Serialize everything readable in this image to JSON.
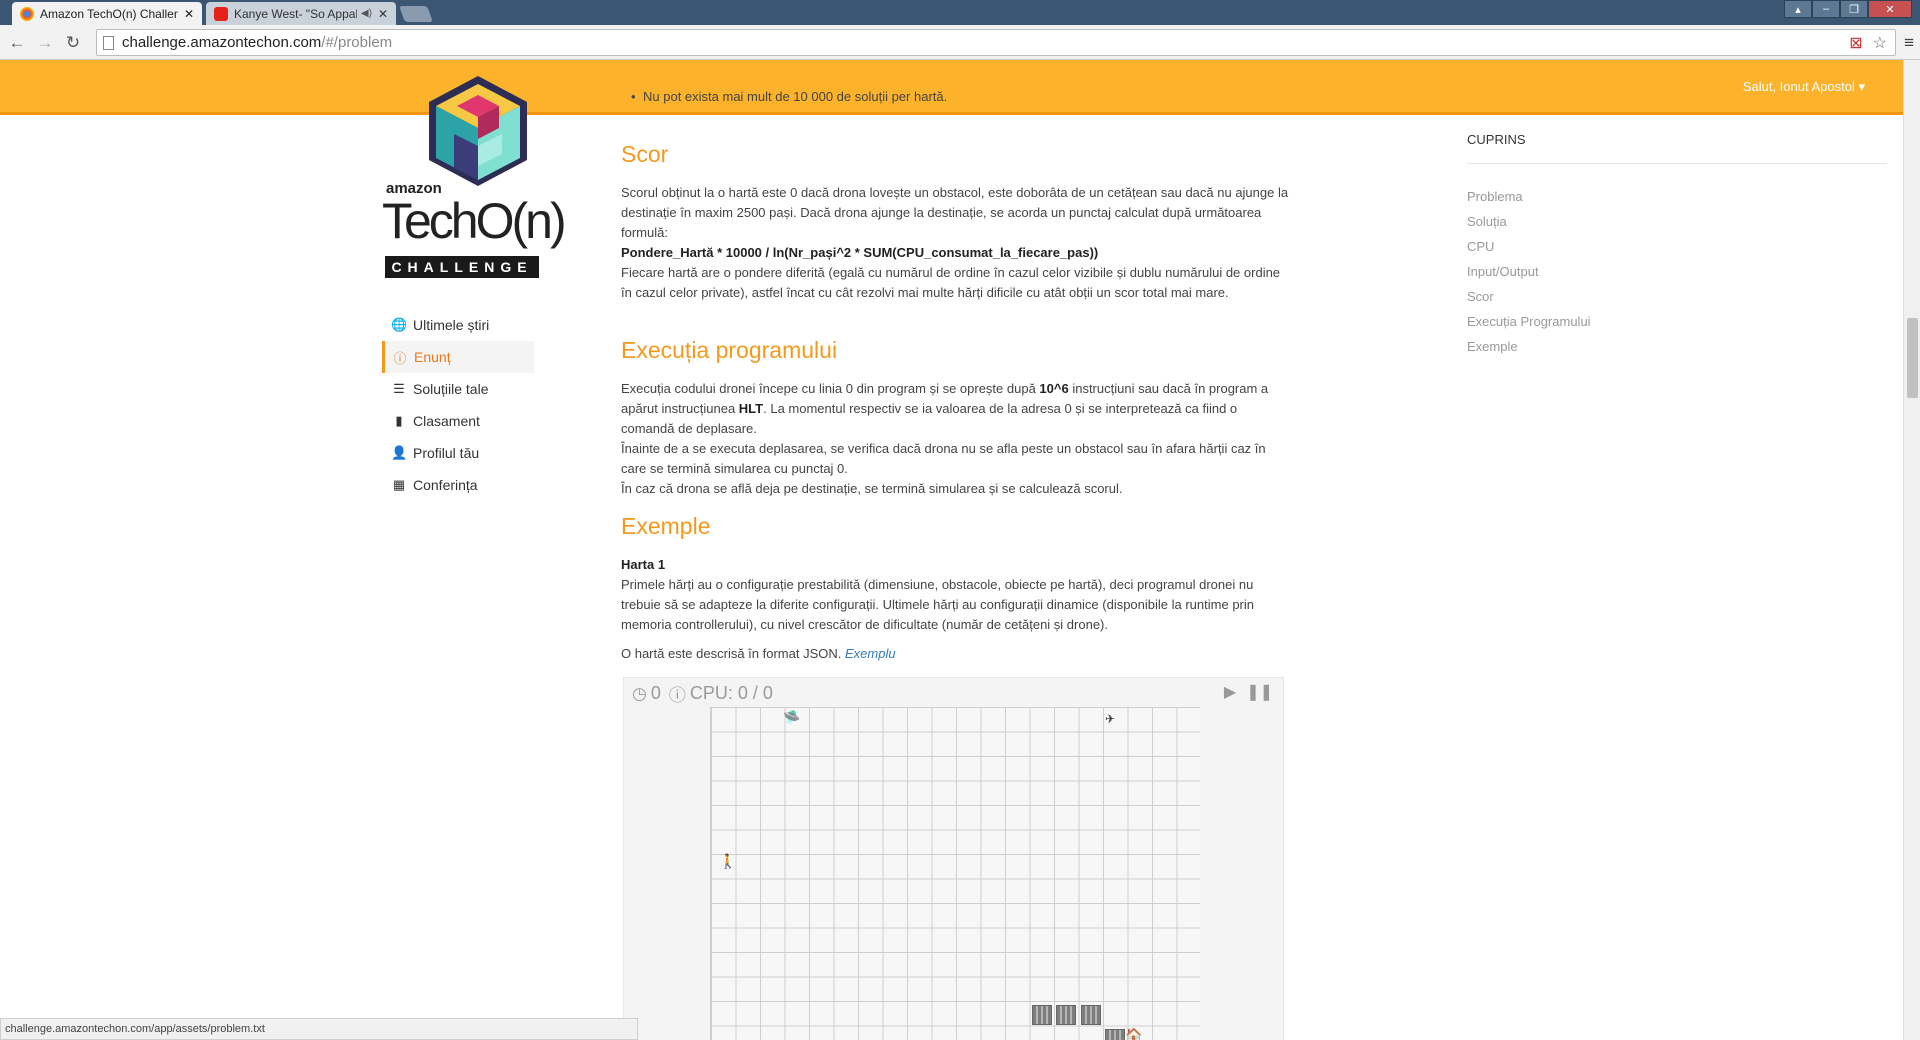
{
  "browser": {
    "tabs": [
      {
        "title": "Amazon TechO(n) Challen",
        "active": true
      },
      {
        "title": "Kanye West- \"So Appal",
        "active": false,
        "audio": true
      }
    ],
    "url_host": "challenge.amazontechon.com",
    "url_path": "/#/problem",
    "status_url": "challenge.amazontechon.com/app/assets/problem.txt"
  },
  "header": {
    "greeting": "Salut, Ionut Apostol ▾",
    "accent": "#fcb32b"
  },
  "logo": {
    "brand": "amazon",
    "wordmark": "TechO(n)",
    "tagline": "CHALLENGE"
  },
  "sidebar": {
    "items": [
      {
        "label": "Ultimele știri",
        "icon": "globe-icon"
      },
      {
        "label": "Enunț",
        "icon": "info-icon",
        "active": true
      },
      {
        "label": "Soluțiile tale",
        "icon": "list-icon"
      },
      {
        "label": "Clasament",
        "icon": "bar-chart-icon"
      },
      {
        "label": "Profilul tău",
        "icon": "user-icon"
      },
      {
        "label": "Conferința",
        "icon": "calendar-icon"
      }
    ]
  },
  "content": {
    "bullet": "Nu pot exista mai mult de 10 000 de soluții per hartă.",
    "scor": {
      "heading": "Scor",
      "p1": "Scorul obținut la o hartă este 0 dacă drona lovește un obstacol, este doborâta de un cetățean sau dacă nu ajunge la destinație în maxim 2500 pași. Dacă drona ajunge la destinație, se acorda un punctaj calculat după următoarea formulă:",
      "formula": "Pondere_Hartă * 10000 / ln(Nr_pași^2 * SUM(CPU_consumat_la_fiecare_pas))",
      "p2": "Fiecare hartă are o pondere diferită (egală cu numărul de ordine în cazul celor vizibile și dublu numărului de ordine în cazul celor private), astfel încat cu cât rezolvi mai multe hărți dificile cu atât obții un scor total mai mare."
    },
    "executie": {
      "heading": "Execuția programului",
      "l1a": "Execuția codului dronei începe cu linia 0 din program și se oprește după ",
      "l1b": "10^6",
      "l1c": " instrucțiuni sau dacă în program a apărut instrucțiunea ",
      "l1d": "HLT",
      "l1e": ". La momentul respectiv se ia valoarea de la adresa 0 și se interpretează ca fiind o comandă de deplasare.",
      "l2": "Înainte de a se executa deplasarea, se verifica dacă drona nu se afla peste un obstacol sau în afara hărții caz în care se termină simularea cu punctaj 0.",
      "l3": "În caz că drona se află deja pe destinație, se termină simularea și se calculează scorul."
    },
    "exemple": {
      "heading": "Exemple",
      "subheading": "Harta 1",
      "p1": "Primele hărți au o configurație prestabilită (dimensiune, obstacole, obiecte pe hartă), deci programul dronei nu trebuie să se adapteze la diferite configurații. Ultimele hărți au configurații dinamice (disponibile la runtime prin memoria controllerului), cu nivel crescător de dificultate (număr de cetățeni și drone).",
      "p2": "O hartă este descrisă în format JSON. ",
      "link": "Exemplu"
    }
  },
  "simulator": {
    "time": "0",
    "cpu": "CPU: 0 / 0"
  },
  "toc": {
    "title": "CUPRINS",
    "items": [
      "Problema",
      "Soluția",
      "CPU",
      "Input/Output",
      "Scor",
      "Execuția Programului",
      "Exemple"
    ]
  }
}
